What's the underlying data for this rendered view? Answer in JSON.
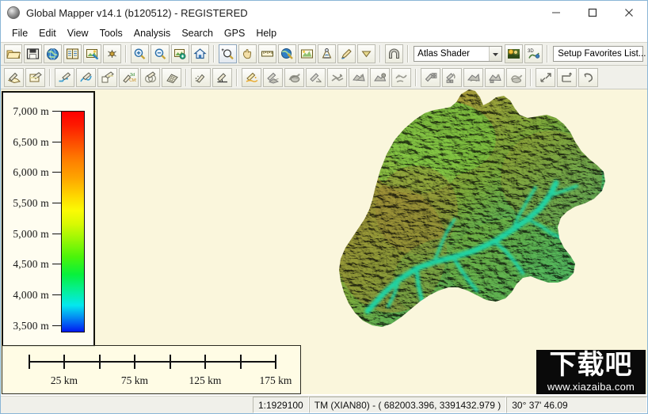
{
  "window": {
    "title": "Global Mapper v14.1 (b120512) - REGISTERED",
    "app_icon": "globe-sphere-icon",
    "minimize_label": "–",
    "maximize_label": "☐",
    "close_label": "✕"
  },
  "menubar": {
    "items": [
      {
        "label": "File"
      },
      {
        "label": "Edit"
      },
      {
        "label": "View"
      },
      {
        "label": "Tools"
      },
      {
        "label": "Analysis"
      },
      {
        "label": "Search"
      },
      {
        "label": "GPS"
      },
      {
        "label": "Help"
      }
    ]
  },
  "toolbar_row1": {
    "groups": [
      {
        "buttons": [
          {
            "icon": "open-folder-icon"
          },
          {
            "icon": "save-disk-icon"
          },
          {
            "icon": "globe-icon"
          },
          {
            "icon": "overlay-control-center-icon"
          },
          {
            "icon": "configure-icon"
          },
          {
            "icon": "spider-tools-icon"
          }
        ]
      },
      {
        "buttons": [
          {
            "icon": "zoom-in-icon"
          },
          {
            "icon": "zoom-out-icon"
          },
          {
            "icon": "zoom-to-layer-icon"
          },
          {
            "icon": "home-zoom-full-icon"
          }
        ]
      },
      {
        "buttons": [
          {
            "icon": "zoom-select-tool-icon"
          },
          {
            "icon": "pan-hand-icon"
          },
          {
            "icon": "measure-ruler-icon"
          },
          {
            "icon": "feature-info-icon"
          },
          {
            "icon": "path-profile-icon"
          },
          {
            "icon": "view-shed-icon"
          },
          {
            "icon": "digitizer-edit-icon"
          },
          {
            "icon": "chevron-down-icon"
          }
        ]
      },
      {
        "buttons": [
          {
            "icon": "3d-path-arch-icon"
          }
        ]
      }
    ],
    "shader_combo": {
      "value": "Atlas Shader",
      "arrow_icon": "chevron-down-icon"
    },
    "extra_buttons": [
      {
        "icon": "shader-options-icon"
      },
      {
        "icon": "3d-view-icon"
      }
    ],
    "favorites_field": {
      "value": "Setup Favorites List..."
    }
  },
  "toolbar_row2": {
    "buttons": [
      {
        "icon": "digitizer-create-area-icon"
      },
      {
        "icon": "digitizer-create-rect-icon"
      },
      {
        "icon": "create-line-icon"
      },
      {
        "icon": "create-curve-icon"
      },
      {
        "icon": "create-square-icon"
      },
      {
        "icon": "create-3d-path-icon"
      },
      {
        "icon": "create-circle-icon"
      },
      {
        "icon": "create-grid-icon"
      },
      {
        "icon": "create-point-icon"
      },
      {
        "icon": "create-vertex-icon"
      },
      {
        "icon": "draw-highlight-icon"
      },
      {
        "icon": "edit-features-icon"
      },
      {
        "icon": "move-features-icon"
      },
      {
        "icon": "rotate-features-icon"
      },
      {
        "icon": "scale-features-icon"
      },
      {
        "icon": "combine-features-icon"
      },
      {
        "icon": "split-features-icon"
      },
      {
        "icon": "crop-features-icon"
      },
      {
        "icon": "advanced-features-icon"
      },
      {
        "icon": "attribute-edit-icon"
      },
      {
        "icon": "copy-features-icon"
      },
      {
        "icon": "delete-features-icon"
      },
      {
        "icon": "convert-features-icon"
      },
      {
        "icon": "paint-features-icon"
      },
      {
        "icon": "undo-arrow-icon"
      },
      {
        "icon": "measure-angle-icon"
      },
      {
        "icon": "redo-arrow-icon"
      }
    ]
  },
  "legend": {
    "title": "elevation-legend",
    "unit": "m",
    "labels": [
      {
        "value": "7,000 m",
        "pos_pct": 0
      },
      {
        "value": "6,500 m",
        "pos_pct": 13.8
      },
      {
        "value": "6,000 m",
        "pos_pct": 27.6
      },
      {
        "value": "5,500 m",
        "pos_pct": 41.4
      },
      {
        "value": "5,000 m",
        "pos_pct": 55.2
      },
      {
        "value": "4,500 m",
        "pos_pct": 69.0
      },
      {
        "value": "4,000 m",
        "pos_pct": 82.8
      },
      {
        "value": "3,500 m",
        "pos_pct": 96.5
      }
    ],
    "gradient_top_color": "#fe0000",
    "gradient_bottom_color": "#0118ef"
  },
  "scalebar": {
    "ticks_count": 8,
    "labels": [
      {
        "text": "25 km",
        "pos_pct": 14.3
      },
      {
        "text": "75 km",
        "pos_pct": 42.9
      },
      {
        "text": "125 km",
        "pos_pct": 71.4
      },
      {
        "text": "175 km",
        "pos_pct": 100
      }
    ]
  },
  "map": {
    "background_color": "#faf6dc",
    "terrain_description": "shaded-relief-elevation-raster"
  },
  "watermark": {
    "cn_text": "下载吧",
    "url_text": "www.xiazaiba.com"
  },
  "statusbar": {
    "cells": [
      {
        "text": "1:1929100"
      },
      {
        "text": "TM (XIAN80) - ( 682003.396, 3391432.979 )"
      },
      {
        "text": "30° 37' 46.09"
      }
    ]
  }
}
